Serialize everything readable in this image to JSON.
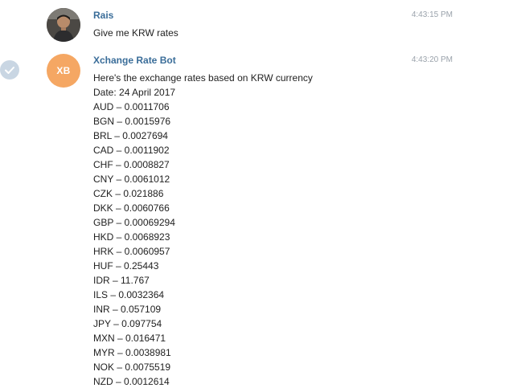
{
  "messages": [
    {
      "sender": "Rais",
      "time": "4:43:15 PM",
      "text": "Give me KRW rates",
      "avatar": "user-photo"
    },
    {
      "sender": "Xchange Rate Bot",
      "avatar_initials": "XB",
      "time": "4:43:20 PM",
      "intro": "Here's the exchange rates based on KRW currency",
      "date": "Date: 24 April 2017",
      "rates": [
        "AUD – 0.0011706",
        "BGN – 0.0015976",
        "BRL – 0.0027694",
        "CAD – 0.0011902",
        "CHF – 0.0008827",
        "CNY – 0.0061012",
        "CZK – 0.021886",
        "DKK – 0.0060766",
        "GBP – 0.00069294",
        "HKD – 0.0068923",
        "HRK – 0.0060957",
        "HUF – 0.25443",
        "IDR – 11.767",
        "ILS – 0.0032364",
        "INR – 0.057109",
        "JPY – 0.097754",
        "MXN – 0.016471",
        "MYR – 0.0038981",
        "NOK – 0.0075519",
        "NZD – 0.0012614"
      ],
      "selected": true
    }
  ],
  "colors": {
    "sender_name": "#3a6d99",
    "timestamp": "#9aa2ab",
    "bot_avatar": "#f5a763",
    "check_circle": "#c9d6e3"
  }
}
